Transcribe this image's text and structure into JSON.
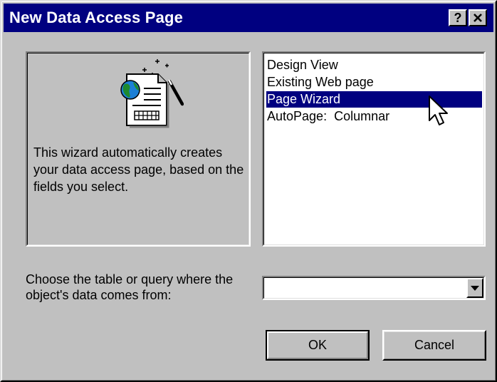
{
  "dialog": {
    "title": "New Data Access Page",
    "help_button": "?",
    "close_button": "×"
  },
  "preview": {
    "icon": "page-wizard-icon",
    "description": "This wizard automatically creates your data access page, based on the fields you select."
  },
  "options": {
    "items": [
      "Design View",
      "Existing Web page",
      "Page Wizard",
      "AutoPage:  Columnar"
    ],
    "selected": "Page Wizard"
  },
  "source": {
    "label": "Choose the table or query where the object's data comes from:",
    "value": ""
  },
  "buttons": {
    "ok": "OK",
    "cancel": "Cancel"
  },
  "colors": {
    "title_bar": "#000080",
    "face": "#c0c0c0",
    "selection": "#000080"
  }
}
